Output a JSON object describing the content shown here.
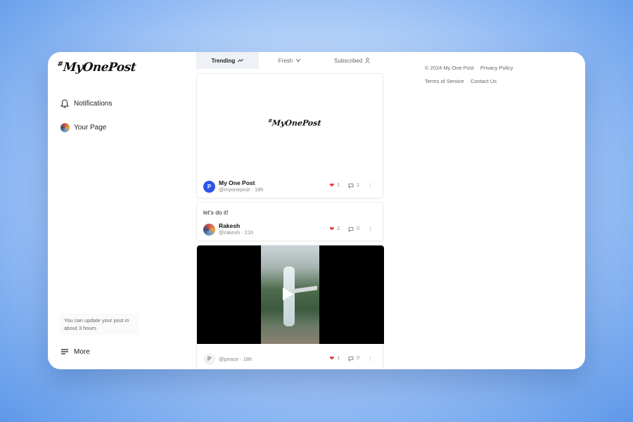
{
  "brand": {
    "logo_hash": "#",
    "logo_text": "MyOnePost"
  },
  "sidebar": {
    "items": [
      {
        "label": "Notifications",
        "icon": "bell-icon"
      },
      {
        "label": "Your Page",
        "icon": "avatar"
      }
    ],
    "update_note": "You can update your post in about 3 hours",
    "more_label": "More"
  },
  "tabs": [
    {
      "label": "Trending",
      "icon": "trending-icon",
      "active": true
    },
    {
      "label": "Fresh",
      "icon": "sparkle-icon",
      "active": false
    },
    {
      "label": "Subscribed",
      "icon": "person-icon",
      "active": false
    }
  ],
  "posts": [
    {
      "author": "My One Post",
      "handle": "@myonepost",
      "time": "18h",
      "likes": "1",
      "comments": "1",
      "avatar_letter": "P",
      "avatar_color": "#2f54eb"
    },
    {
      "text": "let's do it!",
      "author": "Rakesh",
      "handle": "@rakesh",
      "time": "21h",
      "likes": "2",
      "comments": "0"
    },
    {
      "author": "",
      "handle": "@peace",
      "time": "18h",
      "likes": "1",
      "comments": "0",
      "avatar_letter": "P"
    }
  ],
  "footer": {
    "copyright": "© 2024 My One Post",
    "privacy": "Privacy Policy",
    "terms": "Terms of Service",
    "contact": "Contact Us"
  },
  "colors": {
    "heart": "#e0393e",
    "accent": "#2f54eb"
  }
}
